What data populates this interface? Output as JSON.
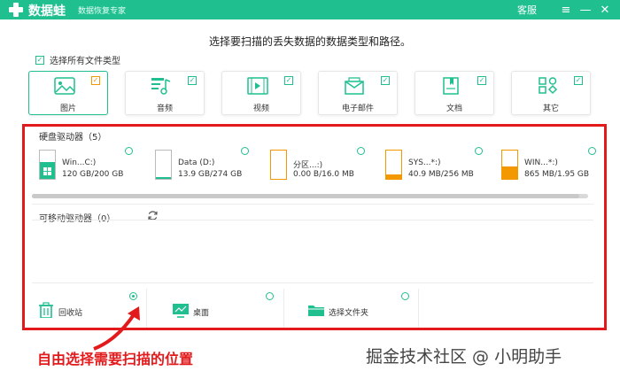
{
  "app": {
    "name": "数据蛙",
    "subtitle": "数据恢复专家",
    "support_label": "客服",
    "menu_icon": "hamburger-icon",
    "minimize_icon": "minimize-icon",
    "close_icon": "close-icon",
    "brand_color": "#1fbf8f"
  },
  "prompt": "选择要扫描的丢失数据的数据类型和路径。",
  "select_all": {
    "label": "选择所有文件类型",
    "checked": true
  },
  "file_types": [
    {
      "label": "图片",
      "icon": "image-icon",
      "checked": true,
      "active": true
    },
    {
      "label": "音频",
      "icon": "music-icon",
      "checked": true
    },
    {
      "label": "视频",
      "icon": "video-icon",
      "checked": true
    },
    {
      "label": "电子邮件",
      "icon": "email-icon",
      "checked": true
    },
    {
      "label": "文档",
      "icon": "document-icon",
      "checked": true
    },
    {
      "label": "其它",
      "icon": "other-icon",
      "checked": true
    }
  ],
  "hard_drives": {
    "title": "硬盘驱动器（5）",
    "items": [
      {
        "name": "Win...C:)",
        "size": "120 GB/200 GB",
        "usage": 0.6,
        "fill_color": "#1fbf8f",
        "os_icon": "windows-icon"
      },
      {
        "name": "Data (D:)",
        "size": "13.9 GB/274 GB",
        "usage": 0.05,
        "fill_color": "#1fbf8f"
      },
      {
        "name": "分区...:)",
        "size": "0.00  B/16.0 MB",
        "usage": 0.0,
        "fill_color": "#f39800"
      },
      {
        "name": "SYS...*:)",
        "size": "40.9 MB/256 MB",
        "usage": 0.16,
        "fill_color": "#f39800"
      },
      {
        "name": "WIN...*:)",
        "size": "865 MB/1.95 GB",
        "usage": 0.44,
        "fill_color": "#f39800"
      }
    ]
  },
  "removable": {
    "title": "可移动驱动器（0）",
    "refresh_icon": "refresh-icon"
  },
  "locations": [
    {
      "label": "回收站",
      "icon": "trash-icon",
      "selected": true
    },
    {
      "label": "桌面",
      "icon": "desktop-icon",
      "selected": false
    },
    {
      "label": "选择文件夹",
      "icon": "folder-icon",
      "selected": false
    }
  ],
  "annotation": "自由选择需要扫描的位置",
  "watermark": "掘金技术社区 @ 小明助手",
  "highlight_color": "#e31a1c"
}
